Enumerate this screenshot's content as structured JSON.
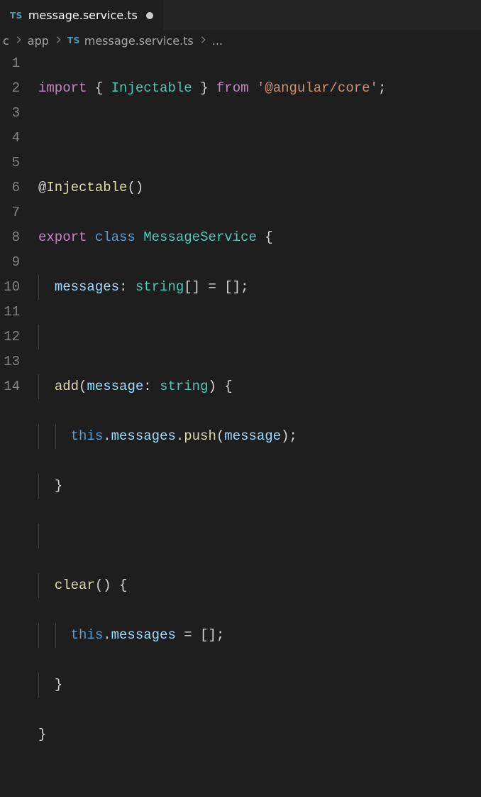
{
  "tab": {
    "filename": "message.service.ts",
    "dirty": true,
    "language_badge": "TS"
  },
  "breadcrumbs": {
    "items": [
      "c",
      "app",
      "message.service.ts"
    ],
    "trailing": "..."
  },
  "editor": {
    "line_count": 14,
    "tokens": {
      "import": "import",
      "from": "from",
      "export": "export",
      "class": "class",
      "this": "this",
      "Injectable": "Injectable",
      "string": "string",
      "MessageService": "MessageService",
      "messages_field": "messages",
      "add": "add",
      "push": "push",
      "clear": "clear",
      "message_param": "message",
      "import_path": "'@angular/core'"
    },
    "source": "import { Injectable } from '@angular/core';\n\n@Injectable()\nexport class MessageService {\n  messages: string[] = [];\n\n  add(message: string) {\n    this.messages.push(message);\n  }\n\n  clear() {\n    this.messages = [];\n  }\n}"
  },
  "colors": {
    "background": "#1e1e1e",
    "tabbar": "#252526",
    "keyword_flow": "#c586c0",
    "keyword_decl": "#569cd6",
    "type": "#4ec9b0",
    "string": "#ce9178",
    "function": "#dcdcaa",
    "variable": "#9cdcfe",
    "punctuation": "#d4d4d4",
    "linenumber": "#858585"
  }
}
